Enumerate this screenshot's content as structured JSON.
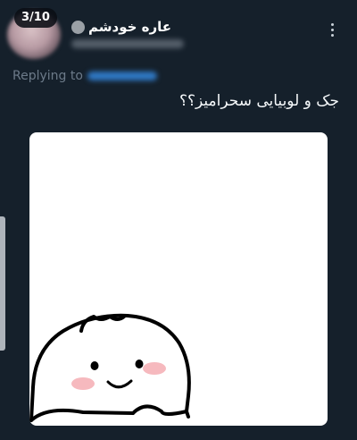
{
  "tweet": {
    "counter": "3/10",
    "display_name": "عاره خودشم",
    "replying_label": "Replying to",
    "text": "جک و لوبیایی سحرامیز؟؟"
  },
  "icons": {
    "more": "vertical-ellipsis-icon",
    "status": "status-dot-icon"
  },
  "colors": {
    "background": "#15202b",
    "mention": "#2f78c4",
    "muted_text": "#6c7a89"
  }
}
